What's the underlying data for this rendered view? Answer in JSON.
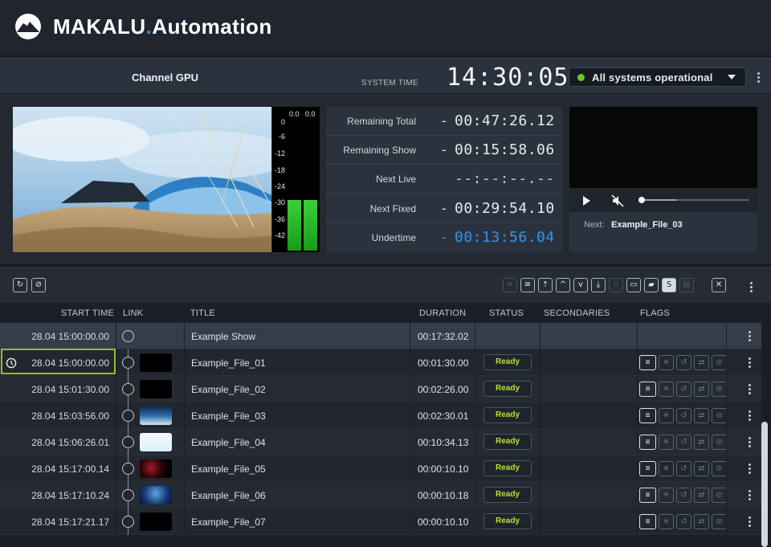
{
  "brand": {
    "name_part1": "MAKALU",
    "name_dot": ".",
    "name_part2": "Automation"
  },
  "header": {
    "channel": "Channel GPU",
    "system_time_label": "SYSTEM TIME",
    "system_time": "14:30:05",
    "status": {
      "text": "All systems operational",
      "color": "#6cc72b"
    }
  },
  "vu_meter": {
    "top_labels": [
      "0.0",
      "0.0"
    ],
    "scale": [
      "0",
      "-6",
      "-12",
      "-18",
      "-24",
      "-30",
      "-36",
      "-42"
    ]
  },
  "timers": [
    {
      "label": "Remaining Total",
      "sign": "-",
      "value": "00:47:26.12",
      "style": "normal"
    },
    {
      "label": "Remaining Show",
      "sign": "-",
      "value": "00:15:58.06",
      "style": "normal"
    },
    {
      "label": "Next Live",
      "sign": "",
      "value": "--:--:--.--",
      "style": "dim"
    },
    {
      "label": "Next Fixed",
      "sign": "-",
      "value": "00:29:54.10",
      "style": "normal"
    },
    {
      "label": "Undertime",
      "sign": "-",
      "value": "00:13:56.04",
      "style": "blue"
    }
  ],
  "player": {
    "next_label": "Next:",
    "next_value": "Example_File_03",
    "progress": 0.33
  },
  "toolbar": {
    "left_icons": [
      "refresh-icon",
      "timer-off-icon"
    ],
    "right_icons": [
      "list-disabled-icon",
      "list-icon",
      "move-top-icon",
      "move-up-icon",
      "move-down-icon",
      "move-bottom-icon",
      "lock-icon",
      "card-icon",
      "graphics-icon",
      "script-icon",
      "note-disabled-icon",
      "delete-icon"
    ]
  },
  "table": {
    "headers": {
      "start_time": "START TIME",
      "link": "LINK",
      "title": "TITLE",
      "duration": "DURATION",
      "status": "STATUS",
      "secondaries": "SECONDARIES",
      "flags": "FLAGS"
    },
    "show_row": {
      "start": "28.04  15:00:00.00",
      "title": "Example Show",
      "duration": "00:17:32.02"
    },
    "rows": [
      {
        "start": "28.04  15:00:00.00",
        "title": "Example_File_01",
        "duration": "00:01:30.00",
        "status": "Ready",
        "thumb": "black"
      },
      {
        "start": "28.04  15:01:30.00",
        "title": "Example_File_02",
        "duration": "00:02:26.00",
        "status": "Ready",
        "thumb": "black"
      },
      {
        "start": "28.04  15:03:56.00",
        "title": "Example_File_03",
        "duration": "00:02:30.01",
        "status": "Ready",
        "thumb": "ocean"
      },
      {
        "start": "28.04  15:06:26.01",
        "title": "Example_File_04",
        "duration": "00:10:34.13",
        "status": "Ready",
        "thumb": "sky"
      },
      {
        "start": "28.04  15:17:00.14",
        "title": "Example_File_05",
        "duration": "00:00:10.10",
        "status": "Ready",
        "thumb": "red"
      },
      {
        "start": "28.04  15:17:10.24",
        "title": "Example_File_06",
        "duration": "00:00:10.18",
        "status": "Ready",
        "thumb": "blue"
      },
      {
        "start": "28.04  15:17:21.17",
        "title": "Example_File_07",
        "duration": "00:00:10.10",
        "status": "Ready",
        "thumb": "black"
      }
    ]
  }
}
